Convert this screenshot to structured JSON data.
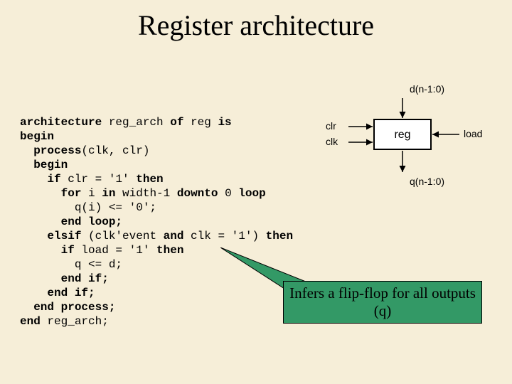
{
  "title": "Register architecture",
  "code": {
    "l1a": "architecture",
    "l1b": " reg_arch ",
    "l1c": "of",
    "l1d": " reg ",
    "l1e": "is",
    "l2": "begin",
    "l3a": "  ",
    "l3b": "process",
    "l3c": "(clk, clr)",
    "l4": "  begin",
    "l5a": "    ",
    "l5b": "if",
    "l5c": " clr = '1' ",
    "l5d": "then",
    "l6a": "      ",
    "l6b": "for",
    "l6c": " i ",
    "l6d": "in",
    "l6e": " width-1 ",
    "l6f": "downto",
    "l6g": " 0 ",
    "l6h": "loop",
    "l7": "        q(i) <= '0';",
    "l8a": "      ",
    "l8b": "end loop;",
    "l9a": "    ",
    "l9b": "elsif",
    "l9c": " (clk'event ",
    "l9d": "and",
    "l9e": " clk = '1') ",
    "l9f": "then",
    "l10a": "      ",
    "l10b": "if",
    "l10c": " load = '1' ",
    "l10d": "then",
    "l11": "        q <= d;",
    "l12a": "      ",
    "l12b": "end if;",
    "l13a": "    ",
    "l13b": "end if;",
    "l14a": "  ",
    "l14b": "end process;",
    "l15a": "",
    "l15b": "end",
    "l15c": " reg_arch;"
  },
  "diagram": {
    "top": "d(n-1:0)",
    "left1": "clr",
    "left2": "clk",
    "center": "reg",
    "right": "load",
    "bottom": "q(n-1:0)"
  },
  "callout": "Infers a flip-flop for all outputs  (q)"
}
